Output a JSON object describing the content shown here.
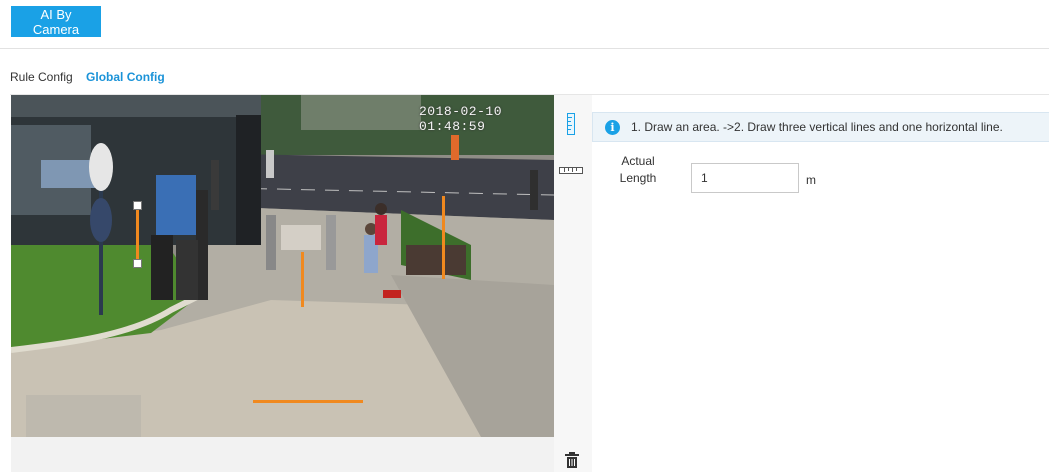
{
  "header": {
    "ai_button_label": "AI By Camera"
  },
  "tabs": [
    {
      "label": "Rule Config",
      "active": false
    },
    {
      "label": "Global Config",
      "active": true
    }
  ],
  "camera": {
    "timestamp": "2018-02-10 01:48:59",
    "line_color": "#f0891f"
  },
  "tools": [
    {
      "name": "vertical-ruler-icon",
      "active": true
    },
    {
      "name": "horizontal-ruler-icon",
      "active": false
    },
    {
      "name": "trash-icon",
      "active": false
    }
  ],
  "panel": {
    "info_text": "1. Draw an area. ->2. Draw three vertical lines and one horizontal line.",
    "actual_length_label": "Actual Length",
    "actual_length_value": "1",
    "unit": "m"
  },
  "colors": {
    "accent": "#1aa1e6",
    "tab_active": "#1b93d8",
    "marker": "#f0891f"
  }
}
